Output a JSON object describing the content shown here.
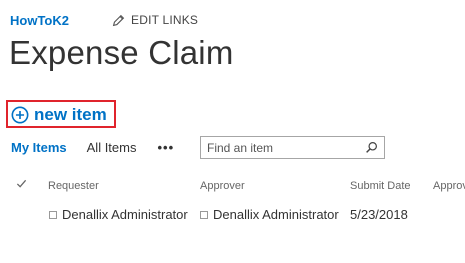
{
  "header": {
    "site_link": "HowToK2",
    "edit_links_label": "EDIT LINKS",
    "edit_icon": "pencil-icon"
  },
  "page": {
    "title": "Expense Claim"
  },
  "toolbar": {
    "new_item_label": "new item",
    "new_item_icon": "circle-plus-icon",
    "highlight_color": "#e0242c"
  },
  "views": {
    "tabs": [
      {
        "label": "My Items",
        "active": true
      },
      {
        "label": "All Items",
        "active": false
      }
    ],
    "more_label": "•••"
  },
  "search": {
    "placeholder": "Find an item",
    "value": "",
    "icon": "search-icon"
  },
  "table": {
    "columns": [
      "Requester",
      "Approver",
      "Submit Date",
      "Approv"
    ],
    "rows": [
      {
        "requester": "Denallix Administrator",
        "approver": "Denallix Administrator",
        "submit_date": "5/23/2018",
        "approval": ""
      }
    ]
  },
  "colors": {
    "accent": "#0072c6",
    "text": "#333333"
  }
}
